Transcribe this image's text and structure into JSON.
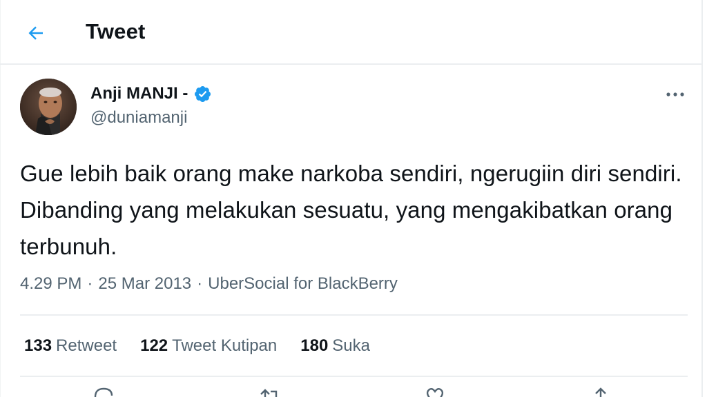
{
  "header": {
    "back_icon": "arrow-left-icon",
    "title": "Tweet"
  },
  "tweet": {
    "author": {
      "display_name": "Anji MANJI -",
      "handle": "@duniamanji",
      "verified_icon": "verified-badge-icon",
      "verified_color": "#1d9bf0"
    },
    "more_icon": "more-horizontal-icon",
    "text": "Gue lebih baik orang make narkoba sendiri, ngerugiin diri sendiri. Dibanding yang melakukan sesuatu, yang mengakibatkan orang terbunuh.",
    "meta": {
      "time": "4.29 PM",
      "sep1": "·",
      "date": "25 Mar 2013",
      "sep2": "·",
      "source": "UberSocial for BlackBerry"
    },
    "stats": [
      {
        "count": "133",
        "label": "Retweet"
      },
      {
        "count": "122",
        "label": "Tweet Kutipan"
      },
      {
        "count": "180",
        "label": "Suka"
      }
    ],
    "actions": [
      "reply-icon",
      "retweet-icon",
      "like-icon",
      "share-icon"
    ]
  },
  "colors": {
    "accent": "#1d9bf0",
    "text": "#0f1419",
    "secondary": "#536471",
    "border": "#ebeef0"
  }
}
